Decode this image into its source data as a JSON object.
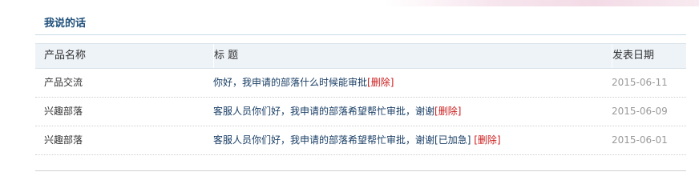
{
  "section": {
    "title": "我说的话"
  },
  "table": {
    "headers": {
      "product": "产品名称",
      "title": "标 题",
      "date": "发表日期"
    },
    "rows": [
      {
        "product": "产品交流",
        "title": "你好，我申请的部落什么时候能审批",
        "badges": [],
        "action": "[删除]",
        "date": "2015-06-11"
      },
      {
        "product": "兴趣部落",
        "title": "客服人员你们好，我申请的部落希望帮忙审批，谢谢",
        "badges": [],
        "action": "[删除]",
        "date": "2015-06-09"
      },
      {
        "product": "兴趣部落",
        "title": "客服人员你们好，我申请的部落希望帮忙审批，谢谢",
        "badges": [
          "[已加急]"
        ],
        "action": "[删除]",
        "date": "2015-06-01"
      }
    ]
  },
  "colors": {
    "title": "#1f4f7a",
    "header_bg": "#eef3f8",
    "delete": "#cc1b1b",
    "date": "#9a9a9a"
  }
}
